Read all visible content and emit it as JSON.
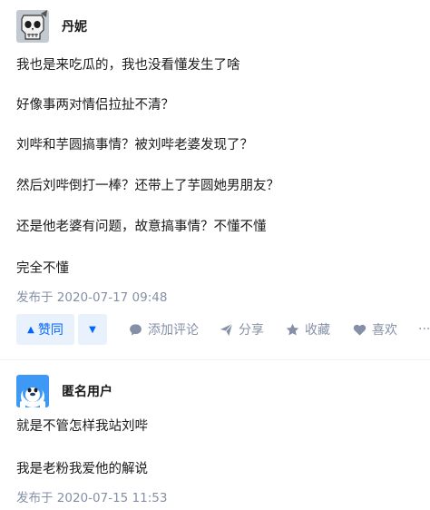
{
  "answers": [
    {
      "author": "丹妮",
      "paragraphs": [
        "我也是来吃瓜的，我也没看懂发生了啥",
        "好像事两对情侣拉扯不清？",
        "刘哔和芋圆搞事情？被刘哔老婆发现了？",
        "然后刘哔倒打一棒？还带上了芋圆她男朋友？",
        "还是他老婆有问题，故意搞事情？不懂不懂",
        "完全不懂"
      ],
      "published": "发布于 2020-07-17 09:48",
      "actions": {
        "upvote_label": "赞同",
        "comment_label": "添加评论",
        "share_label": "分享",
        "collect_label": "收藏",
        "like_label": "喜欢",
        "more_label": "···"
      }
    },
    {
      "author": "匿名用户",
      "paragraphs": [
        "就是不管怎样我站刘哔",
        "我是老粉我爱他的解说"
      ],
      "published": "发布于 2020-07-15 11:53"
    }
  ],
  "colors": {
    "accent": "#0066ff",
    "accent_bg": "#e9f1fd",
    "meta": "#8590a6",
    "text": "#1a1a1a"
  }
}
